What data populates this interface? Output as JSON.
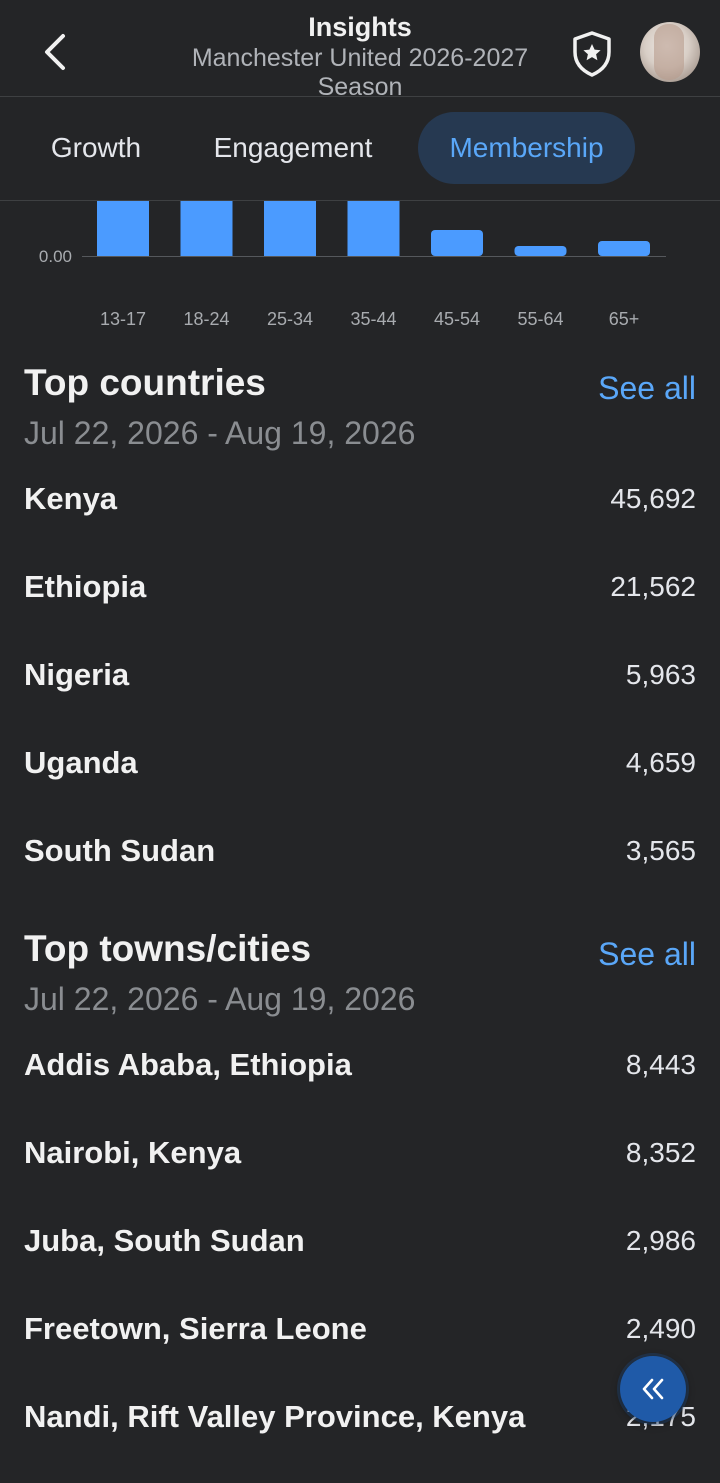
{
  "header": {
    "title": "Insights",
    "subtitle": "Manchester United 2026-2027 Season"
  },
  "tabs": [
    {
      "label": "Growth",
      "active": false
    },
    {
      "label": "Engagement",
      "active": false
    },
    {
      "label": "Membership",
      "active": true
    }
  ],
  "colors": {
    "background": "#242527",
    "accent": "#5aa7f8",
    "bar": "#4b9bff",
    "active_tab_bg": "#263951"
  },
  "icons": {
    "back": "chevron-left-icon",
    "admin": "shield-star-icon",
    "fab": "double-chevron-left-icon"
  },
  "chart_data": {
    "type": "bar",
    "categories": [
      "13-17",
      "18-24",
      "25-34",
      "35-44",
      "45-54",
      "55-64",
      "65+"
    ],
    "values": [
      null,
      null,
      null,
      null,
      0.26,
      0.1,
      0.15
    ],
    "y_tick_labels": [
      "0.00"
    ],
    "visible_ylim": [
      0,
      0.55
    ],
    "note_bars_clipped": true
  },
  "top_countries": {
    "title": "Top countries",
    "see_all": "See all",
    "date_range": "Jul 22, 2026 - Aug 19, 2026",
    "items": [
      {
        "name": "Kenya",
        "value": "45,692"
      },
      {
        "name": "Ethiopia",
        "value": "21,562"
      },
      {
        "name": "Nigeria",
        "value": "5,963"
      },
      {
        "name": "Uganda",
        "value": "4,659"
      },
      {
        "name": "South Sudan",
        "value": "3,565"
      }
    ]
  },
  "top_cities": {
    "title": "Top towns/cities",
    "see_all": "See all",
    "date_range": "Jul 22, 2026 - Aug 19, 2026",
    "items": [
      {
        "name": "Addis Ababa, Ethiopia",
        "value": "8,443"
      },
      {
        "name": "Nairobi, Kenya",
        "value": "8,352"
      },
      {
        "name": "Juba, South Sudan",
        "value": "2,986"
      },
      {
        "name": "Freetown, Sierra Leone",
        "value": "2,490"
      },
      {
        "name": "Nandi, Rift Valley Province, Kenya",
        "value": "2,175"
      }
    ]
  }
}
